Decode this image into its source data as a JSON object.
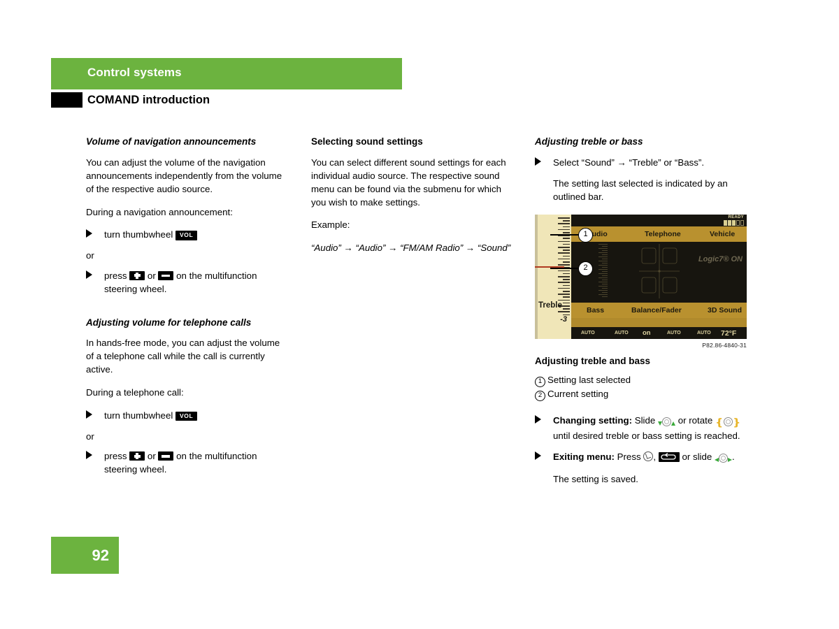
{
  "header": {
    "chapter": "Control systems",
    "section": "COMAND introduction"
  },
  "footer": {
    "page_number": "92"
  },
  "columns": {
    "col1": {
      "s1_title": "Volume of navigation announcements",
      "s1_p1": "You can adjust the volume of the navigation announcements independently from the volume of the respective audio source.",
      "s1_p2": "During a navigation announcement:",
      "s1_b1_pre": "turn thumbwheel",
      "s1_b1_key": "VOL",
      "s1_or": "or",
      "s1_b2_pre": "press",
      "s1_b2_mid": "or",
      "s1_b2_post": "on the multifunction steering wheel.",
      "s2_title": "Adjusting volume for telephone calls",
      "s2_p1": "In hands-free mode, you can adjust the volume of a telephone call while the call is currently active.",
      "s2_p2": "During a telephone call:",
      "s2_b1_pre": "turn thumbwheel",
      "s2_b1_key": "VOL",
      "s2_or": "or",
      "s2_b2_pre": "press",
      "s2_b2_mid": "or",
      "s2_b2_post": "on the multifunction steering wheel."
    },
    "col2": {
      "title": "Selecting sound settings",
      "p1": "You can select different sound settings for each individual audio source. The respective sound menu can be found via the submenu for which you wish to make settings.",
      "p2": "Example:",
      "example_path": "“Audio” → “Audio” → “FM/AM Radio” → “Sound”"
    },
    "col3": {
      "title": "Adjusting treble or bass",
      "b1": "Select “Sound” → “Treble” or “Bass”.",
      "b1_note": "The setting last selected is indicated by an outlined bar.",
      "figure_caption": "P82.86-4840-31",
      "fig_title": "Adjusting treble and bass",
      "legend1": "Setting last selected",
      "legend2": "Current setting",
      "b2_bold": "Changing setting:",
      "b2_t1": "Slide",
      "b2_t2": "or rotate",
      "b2_t3": "until desired treble or bass setting is reached.",
      "b3_bold": "Exiting menu:",
      "b3_t1": "Press",
      "b3_t2": ",",
      "b3_t3": "or slide",
      "b3_t4": ".",
      "b3_note": "The setting is saved."
    }
  },
  "comand_screen": {
    "status_label": "READY",
    "signal_bars_on": 3,
    "signal_bars_off": 2,
    "top_menu": [
      "Audio",
      "Telephone",
      "Vehicle"
    ],
    "bottom_menu": [
      "Bass",
      "Balance/Fader",
      "3D Sound"
    ],
    "left_label": "Treble",
    "left_value": "-3",
    "logic7": "Logic7® ON",
    "callout_1": "1",
    "callout_2": "2",
    "climate": {
      "left_auto": "AUTO",
      "left_fan": "AUTO",
      "center": "on",
      "right_fan": "AUTO",
      "right_auto": "AUTO",
      "temperature": "72°F"
    }
  },
  "colors": {
    "brand_green": "#6cb33f",
    "screen_gold": "#b9912f",
    "screen_bg": "#17150f",
    "screen_cream": "#f0e6b8",
    "accent_red": "#b03a20",
    "arrow_green": "#3aa93a",
    "bracket_gold": "#e8b62c"
  }
}
